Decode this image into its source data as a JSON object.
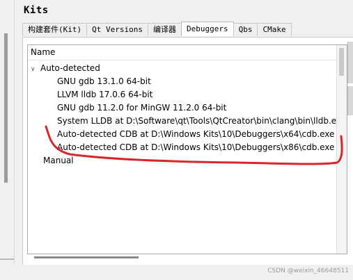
{
  "window": {
    "title": "Kits"
  },
  "tabs": [
    {
      "label": "构建套件(Kit)",
      "active": false
    },
    {
      "label": "Qt Versions",
      "active": false
    },
    {
      "label": "编译器",
      "active": false
    },
    {
      "label": "Debuggers",
      "active": true
    },
    {
      "label": "Qbs",
      "active": false
    },
    {
      "label": "CMake",
      "active": false
    }
  ],
  "tree": {
    "header": "Name",
    "groups": [
      {
        "label": "Auto-detected",
        "expanded": true,
        "items": [
          "GNU gdb 13.1.0 64-bit",
          "LLVM lldb 17.0.6 64-bit",
          "GNU gdb 11.2.0 for MinGW 11.2.0 64-bit",
          "System LLDB at D:\\Software\\qt\\Tools\\QtCreator\\bin\\clang\\bin\\lldb.exe",
          "Auto-detected CDB at D:\\Windows Kits\\10\\Debuggers\\x64\\cdb.exe",
          "Auto-detected CDB at D:\\Windows Kits\\10\\Debuggers\\x86\\cdb.exe"
        ]
      },
      {
        "label": "Manual",
        "expanded": false,
        "items": []
      }
    ]
  },
  "annotation": {
    "color": "#d9262b"
  },
  "watermark": "CSDN @weixin_46648511"
}
